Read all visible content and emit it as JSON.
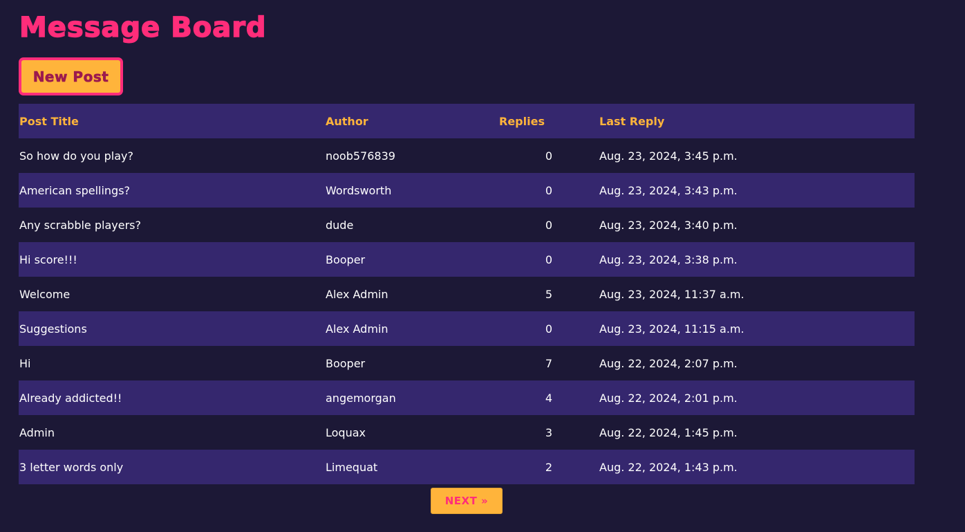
{
  "header": {
    "title": "Message Board"
  },
  "actions": {
    "new_post_label": "New Post"
  },
  "table": {
    "columns": [
      "Post Title",
      "Author",
      "Replies",
      "Last Reply"
    ],
    "rows": [
      {
        "title": "So how do you play?",
        "author": "noob576839",
        "replies": "0",
        "last_reply": "Aug. 23, 2024, 3:45 p.m."
      },
      {
        "title": "American spellings?",
        "author": "Wordsworth",
        "replies": "0",
        "last_reply": "Aug. 23, 2024, 3:43 p.m."
      },
      {
        "title": "Any scrabble players?",
        "author": "dude",
        "replies": "0",
        "last_reply": "Aug. 23, 2024, 3:40 p.m."
      },
      {
        "title": "Hi score!!!",
        "author": "Booper",
        "replies": "0",
        "last_reply": "Aug. 23, 2024, 3:38 p.m."
      },
      {
        "title": "Welcome",
        "author": "Alex Admin",
        "replies": "5",
        "last_reply": "Aug. 23, 2024, 11:37 a.m."
      },
      {
        "title": "Suggestions",
        "author": "Alex Admin",
        "replies": "0",
        "last_reply": "Aug. 23, 2024, 11:15 a.m."
      },
      {
        "title": "Hi",
        "author": "Booper",
        "replies": "7",
        "last_reply": "Aug. 22, 2024, 2:07 p.m."
      },
      {
        "title": "Already addicted!!",
        "author": "angemorgan",
        "replies": "4",
        "last_reply": "Aug. 22, 2024, 2:01 p.m."
      },
      {
        "title": "Admin",
        "author": "Loquax",
        "replies": "3",
        "last_reply": "Aug. 22, 2024, 1:45 p.m."
      },
      {
        "title": "3 letter words only",
        "author": "Limequat",
        "replies": "2",
        "last_reply": "Aug. 22, 2024, 1:43 p.m."
      }
    ]
  },
  "pagination": {
    "next_label": "NEXT »"
  },
  "colors": {
    "background": "#1c1836",
    "row_alt": "#35276e",
    "accent_pink": "#ff2d7a",
    "accent_orange": "#ffb43b",
    "text": "#ffffff"
  }
}
